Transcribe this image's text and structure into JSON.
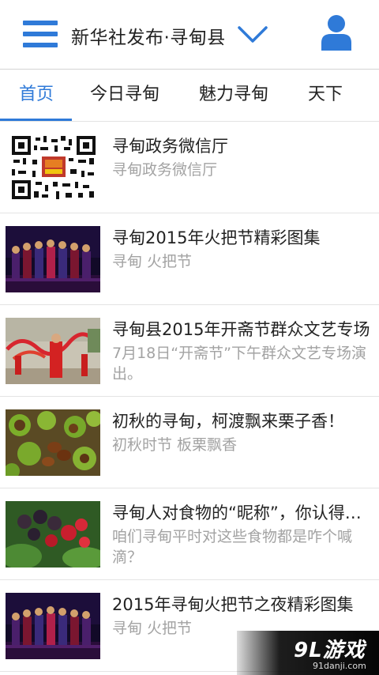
{
  "header": {
    "title": "新华社发布·寻甸县",
    "menu_icon": "hamburger-menu-icon",
    "dropdown_icon": "chevron-down-icon",
    "user_icon": "user-profile-icon",
    "accent_color": "#2f7ad8"
  },
  "tabs": [
    {
      "label": "首页",
      "active": true
    },
    {
      "label": "今日寻甸",
      "active": false
    },
    {
      "label": "魅力寻甸",
      "active": false
    },
    {
      "label": "天下",
      "active": false
    }
  ],
  "news": [
    {
      "title": "寻甸政务微信厅",
      "subtitle": "寻甸政务微信厅",
      "thumb": "qr-code"
    },
    {
      "title": "寻甸2015年火把节精彩图集",
      "subtitle": "寻甸 火把节",
      "thumb": "torch-festival-dance-photo"
    },
    {
      "title": "寻甸县2015年开斋节群众文艺专场",
      "subtitle": "7月18日“开斋节”下午群众文艺专场演出。",
      "thumb": "red-ribbon-dance-photo"
    },
    {
      "title": "初秋的寻甸，柯渡飘来栗子香！",
      "subtitle": "初秋时节 板栗飘香",
      "thumb": "chestnut-photo"
    },
    {
      "title": "寻甸人对食物的“昵称”，你认得几个",
      "subtitle": "咱们寻甸平时对这些食物都是咋个喊滴？",
      "thumb": "raspberry-photo"
    },
    {
      "title": "2015年寻甸火把节之夜精彩图集",
      "subtitle": "寻甸 火把节",
      "thumb": "torch-festival-dance-photo"
    }
  ],
  "watermark": {
    "main": "9L游戏",
    "sub": "91danji.com"
  }
}
